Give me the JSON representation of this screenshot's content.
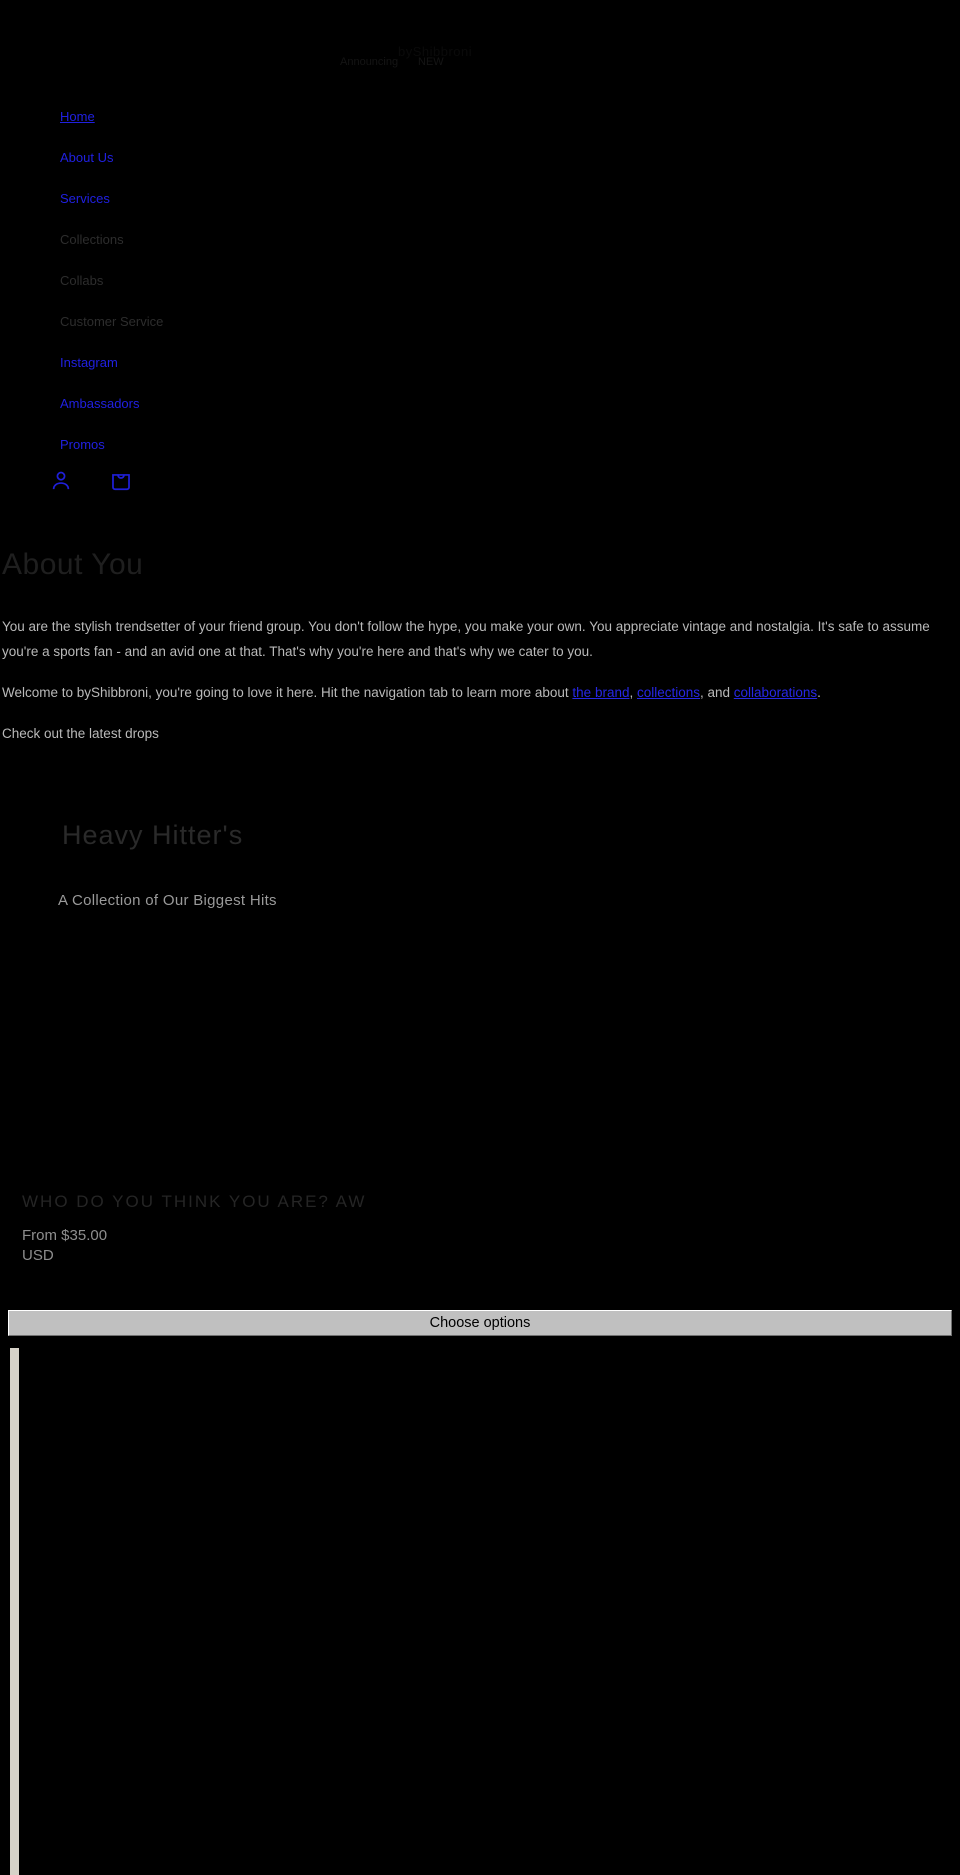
{
  "header": {
    "brand_name": "byShibbroni",
    "announcement_left": "Announcing",
    "announcement_right": "NEW"
  },
  "nav": {
    "items": [
      {
        "label": "Home",
        "state": "link"
      },
      {
        "label": "About Us",
        "state": "link"
      },
      {
        "label": "Services",
        "state": "link"
      },
      {
        "label": "Collections",
        "state": "dim"
      },
      {
        "label": "Collabs",
        "state": "dim"
      },
      {
        "label": "Customer Service",
        "state": "dim"
      },
      {
        "label": "Instagram",
        "state": "link"
      },
      {
        "label": "Ambassadors",
        "state": "link"
      },
      {
        "label": "Promos",
        "state": "link"
      }
    ],
    "icons": [
      {
        "name": "account-icon",
        "label": "Account"
      },
      {
        "name": "cart-icon",
        "label": "Cart"
      }
    ]
  },
  "about": {
    "heading": "About You",
    "paragraph_1": "You are the stylish trendsetter of your friend group. You don't follow the hype, you  make your own. You appreciate vintage and nostalgia. It's safe to assume you're a sports fan - and an avid one at that. That's why you're here and that's why we cater to you.",
    "paragraph_2_pre": "Welcome to byShibbroni, you're going to love it here. Hit the navigation tab to learn more about ",
    "link_brand": "the brand",
    "paragraph_2_mid1": ", ",
    "link_collections": "collections",
    "paragraph_2_mid2": ", and ",
    "link_collabs": "collaborations",
    "paragraph_2_end": ".",
    "drops_line": "Check out the latest drops"
  },
  "collection": {
    "title": "Heavy Hitter's",
    "subtitle": "A Collection of Our Biggest Hits"
  },
  "product": {
    "title": "WHO DO YOU THINK YOU ARE? AW",
    "price": "From $35.00 USD",
    "choose_options_label": "Choose options"
  },
  "colors": {
    "background": "#000000",
    "link": "#2020e0",
    "body_text": "#b9b9b9",
    "dim_text": "#2d2d2d",
    "button_face": "#c0c0c0",
    "rail": "#d6d2c8"
  }
}
